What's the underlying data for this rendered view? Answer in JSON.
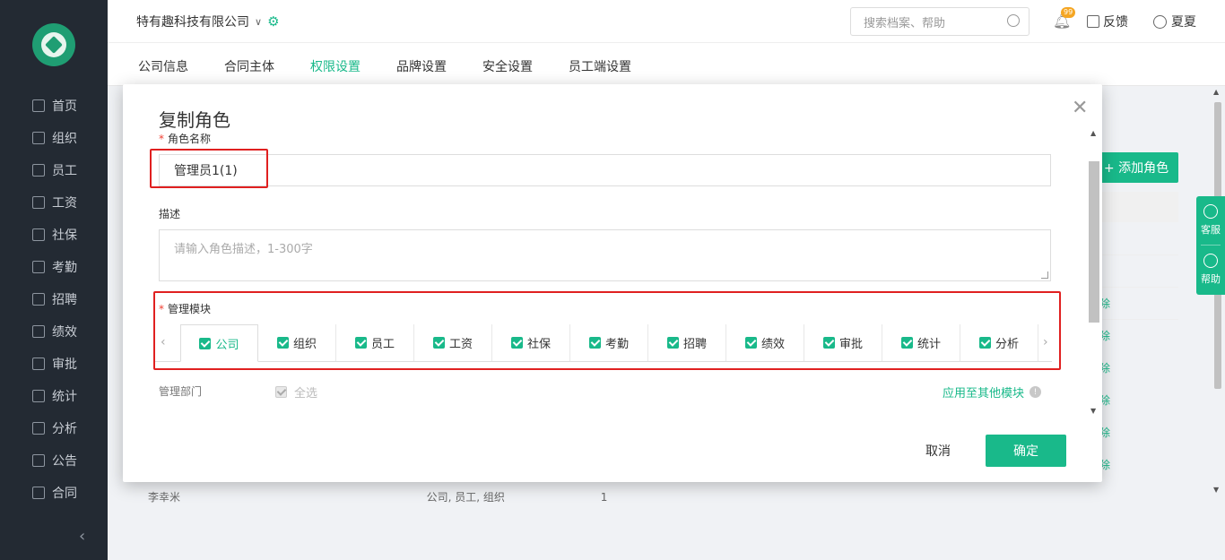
{
  "header": {
    "company": "特有趣科技有限公司",
    "search_placeholder": "搜索档案、帮助",
    "notification_badge": "99",
    "feedback": "反馈",
    "user": "夏夏"
  },
  "sidebar": {
    "items": [
      {
        "label": "首页"
      },
      {
        "label": "组织"
      },
      {
        "label": "员工"
      },
      {
        "label": "工资"
      },
      {
        "label": "社保"
      },
      {
        "label": "考勤"
      },
      {
        "label": "招聘"
      },
      {
        "label": "绩效"
      },
      {
        "label": "审批"
      },
      {
        "label": "统计"
      },
      {
        "label": "分析"
      },
      {
        "label": "公告"
      },
      {
        "label": "合同"
      }
    ]
  },
  "subtabs": [
    {
      "label": "公司信息"
    },
    {
      "label": "合同主体"
    },
    {
      "label": "权限设置"
    },
    {
      "label": "品牌设置"
    },
    {
      "label": "安全设置"
    },
    {
      "label": "员工端设置"
    }
  ],
  "background": {
    "add_role": "+ 添加角色",
    "row_action": "除",
    "bottom_row": "李幸米                                                                        公司, 员工, 组织                            1"
  },
  "float": {
    "service": "客服",
    "help": "帮助"
  },
  "modal": {
    "title": "复制角色",
    "name_label": "角色名称",
    "name_value": "管理员1(1)",
    "desc_label": "描述",
    "desc_placeholder": "请输入角色描述，1-300字",
    "module_label": "管理模块",
    "modules": [
      {
        "label": "公司"
      },
      {
        "label": "组织"
      },
      {
        "label": "员工"
      },
      {
        "label": "工资"
      },
      {
        "label": "社保"
      },
      {
        "label": "考勤"
      },
      {
        "label": "招聘"
      },
      {
        "label": "绩效"
      },
      {
        "label": "审批"
      },
      {
        "label": "统计"
      },
      {
        "label": "分析"
      }
    ],
    "dept_label": "管理部门",
    "select_all": "全选",
    "apply_link": "应用至其他模块",
    "cancel": "取消",
    "confirm": "确定"
  },
  "colors": {
    "accent": "#19b98a",
    "sidebar": "#232a33",
    "highlight": "#e02020"
  }
}
